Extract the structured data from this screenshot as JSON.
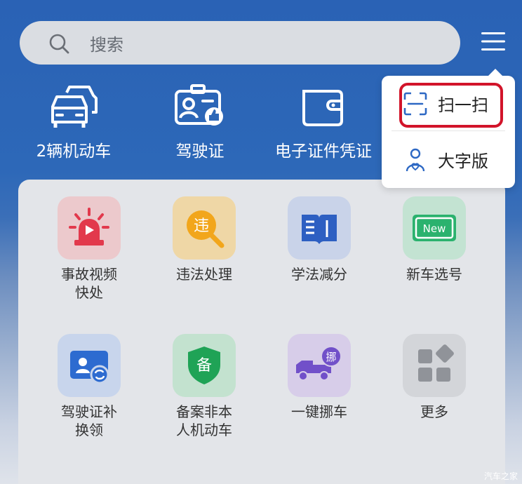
{
  "search": {
    "placeholder": "搜索",
    "icon": "search-icon"
  },
  "menu": {
    "icon": "hamburger-menu-icon"
  },
  "quick_access": [
    {
      "label": "2辆机动车",
      "icon": "vehicles-icon"
    },
    {
      "label": "驾驶证",
      "icon": "license-icon"
    },
    {
      "label": "电子证件凭证",
      "icon": "wallet-icon"
    }
  ],
  "services": [
    {
      "label_lines": [
        "事故视频",
        "快处"
      ],
      "icon": "alarm-video-icon",
      "bg": "#ecc9cc",
      "color": "#e2394c"
    },
    {
      "label_lines": [
        "违法处理"
      ],
      "icon": "violation-search-icon",
      "bg": "#efd7a6",
      "color": "#f2a61b",
      "glyph": "违"
    },
    {
      "label_lines": [
        "学法减分"
      ],
      "icon": "book-icon",
      "bg": "#c9d3e9",
      "color": "#2d5fc2"
    },
    {
      "label_lines": [
        "新车选号"
      ],
      "icon": "new-plate-icon",
      "bg": "#c3e3d2",
      "color": "#2bb26e",
      "glyph": "New"
    },
    {
      "label_lines": [
        "驾驶证补",
        "换领"
      ],
      "icon": "license-renew-icon",
      "bg": "#c8d5ec",
      "color": "#2d6bd0"
    },
    {
      "label_lines": [
        "备案非本",
        "人机动车"
      ],
      "icon": "shield-icon",
      "bg": "#c3e2cf",
      "color": "#1fa356",
      "glyph": "备"
    },
    {
      "label_lines": [
        "一键挪车"
      ],
      "icon": "tow-truck-icon",
      "bg": "#d7cde9",
      "color": "#7150c9",
      "glyph": "挪"
    },
    {
      "label_lines": [
        "更多"
      ],
      "icon": "more-grid-icon",
      "bg": "#d3d5d9",
      "color": "#909399"
    }
  ],
  "dropdown": {
    "items": [
      {
        "label": "扫一扫",
        "icon": "scan-icon"
      },
      {
        "label": "大字版",
        "icon": "elder-mode-icon"
      }
    ],
    "highlight_color": "#d2142a"
  },
  "watermark": {
    "text": "汽车之家"
  }
}
